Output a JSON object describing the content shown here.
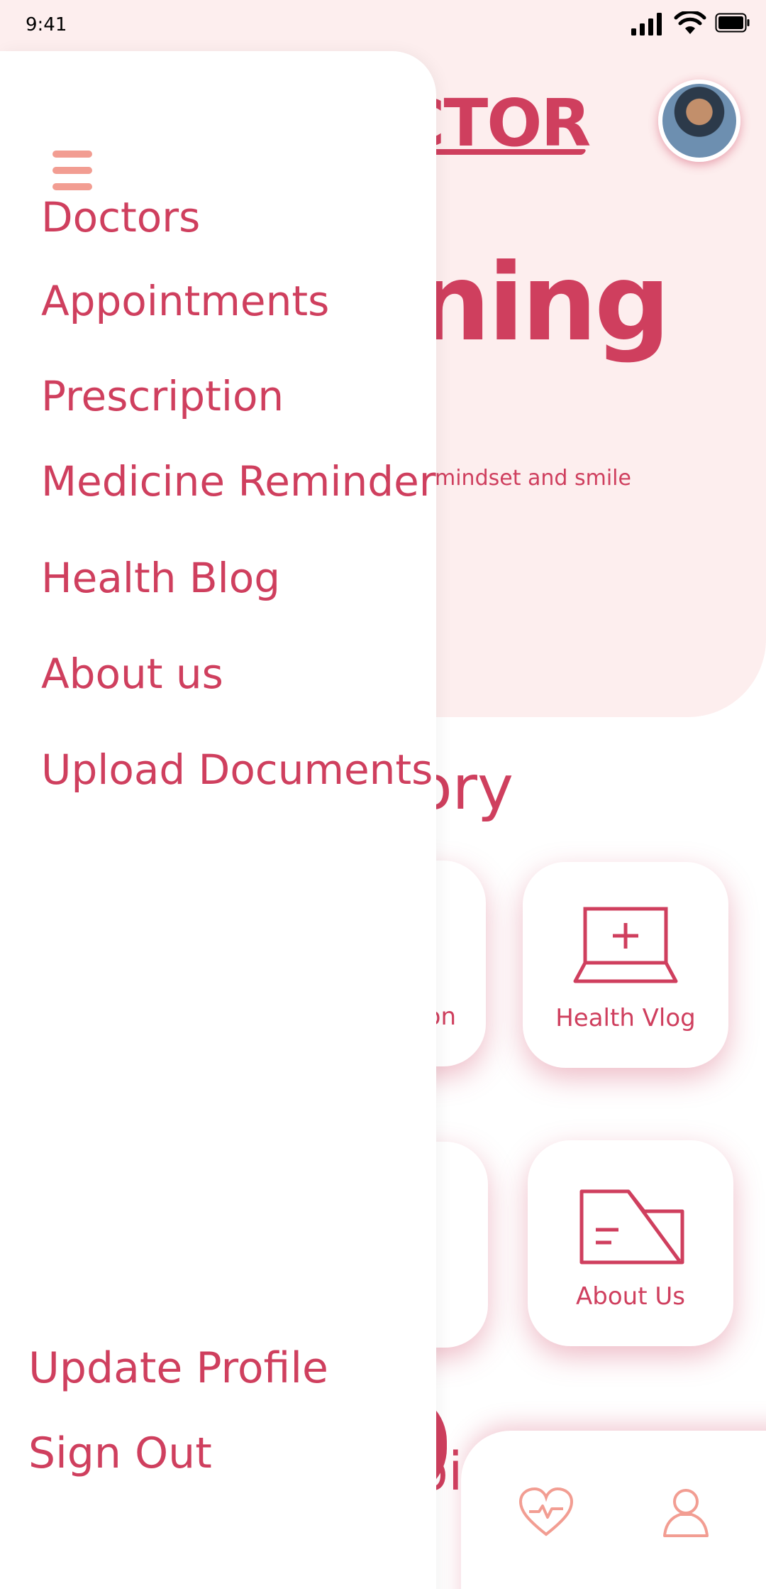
{
  "status_bar": {
    "time": "9:41"
  },
  "header": {
    "brand_fragment": "CTOR",
    "greeting_fragment": "ning",
    "subtext_fragment": "e mindset and smile"
  },
  "category": {
    "title_fragment": "ory",
    "cards": [
      {
        "label": "on",
        "icon": "partial-card-icon"
      },
      {
        "label": "Health Vlog",
        "icon": "laptop-plus-icon"
      },
      {
        "label": ".",
        "icon": "partial-card-icon"
      },
      {
        "label": "About Us",
        "icon": "folder-icon"
      }
    ]
  },
  "peek_text": "bi",
  "bottom_nav": {
    "icons": [
      "heart-pulse-icon",
      "user-icon"
    ]
  },
  "drawer": {
    "menu_icon": "hamburger-icon",
    "items": [
      {
        "label": "Doctors"
      },
      {
        "label": "Appointments"
      },
      {
        "label": "Prescription"
      },
      {
        "label": "Medicine Reminder"
      },
      {
        "label": "Health Blog"
      },
      {
        "label": "About us"
      },
      {
        "label": "Upload Documents"
      }
    ],
    "footer": [
      {
        "label": "Update Profile"
      },
      {
        "label": "Sign Out"
      }
    ]
  },
  "colors": {
    "accent": "#cf3f5e",
    "header_bg": "#fdeeee",
    "hamburger": "#f29d92"
  }
}
